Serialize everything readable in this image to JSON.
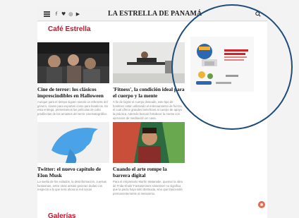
{
  "header": {
    "brand": "LA ESTRELLA DE PANAMÁ",
    "social": [
      "f",
      "♥",
      "◎",
      "▶"
    ]
  },
  "section": {
    "title": "Café Estrella"
  },
  "articles": [
    {
      "headline": "Cine de terror: los clásicos imprescindibles en Halloween",
      "excerpt": "Aunque para el tiempo siguen siendo un referente del género, claves para exportes como para fanáticos. En esta entrega, presentamos las películas de culto predilectas de los amantes del terror cinematográfico."
    },
    {
      "headline": "'Fitness', la condición ideal para el cuerpo y la mente",
      "excerpt": "A fin de lograr el cuerpo deseado, este tipo de hombres están utilizando el entrenamiento de fuerza, el cual ofrece grandes beneficios al cuerpo de apoyo la práctica. Además buscan fortalecer la mente con ejercicios de meditación en casa."
    },
    {
      "headline": "Twitter: el nuevo capítulo de Elon Musk",
      "excerpt": "La suelta de los exilados, la desinformación, cuentas fantasmas, entre otras aristas generan dudas con respecto a lo que será ahora la red social"
    },
    {
      "headline": "Cuando el arte rompe la barrera digital",
      "excerpt": "Para el empresario Martín Watanabe, quemar la obra de Frida Khalo 'Fantasmones siniestros' no significa que la pieza haya sido destruida, sino que trascendió permanentemente al metaverso."
    }
  ],
  "gallery": {
    "title": "Galerías"
  },
  "colors": {
    "accent": "#c8102e",
    "circle": "#1f4b7a"
  }
}
